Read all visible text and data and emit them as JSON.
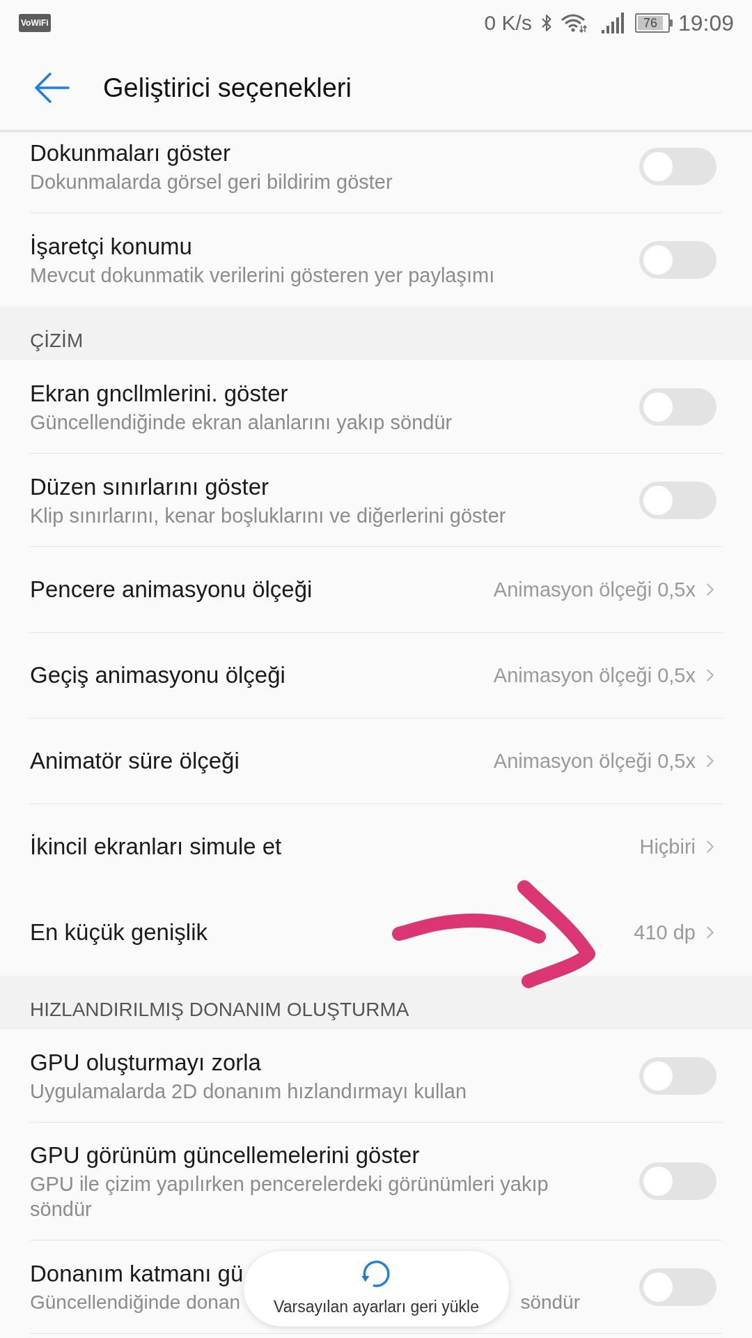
{
  "status_bar": {
    "badge": "VoWiFi",
    "net_speed": "0 K/s",
    "battery": "76",
    "time": "19:09"
  },
  "header": {
    "title": "Geliştirici seçenekleri"
  },
  "sections": [
    {
      "rows": [
        {
          "kind": "toggle",
          "title": "Dokunmaları göster",
          "subtitle": "Dokunmalarda görsel geri bildirim göster",
          "on": false,
          "divider": true
        },
        {
          "kind": "toggle",
          "title": "İşaretçi konumu",
          "subtitle": "Mevcut dokunmatik verilerini gösteren yer paylaşımı",
          "on": false,
          "divider": false
        }
      ]
    },
    {
      "heading": "ÇİZİM",
      "rows": [
        {
          "kind": "toggle",
          "title": "Ekran gncllmlerini. göster",
          "subtitle": "Güncellendiğinde ekran alanlarını yakıp söndür",
          "on": false,
          "divider": true
        },
        {
          "kind": "toggle",
          "title": "Düzen sınırlarını göster",
          "subtitle": "Klip sınırlarını, kenar boşluklarını ve diğerlerini göster",
          "on": false,
          "divider": true
        },
        {
          "kind": "link",
          "title": "Pencere animasyonu ölçeği",
          "value": "Animasyon ölçeği 0,5x",
          "divider": true
        },
        {
          "kind": "link",
          "title": "Geçiş animasyonu ölçeği",
          "value": "Animasyon ölçeği 0,5x",
          "divider": true
        },
        {
          "kind": "link",
          "title": "Animatör süre ölçeği",
          "value": "Animasyon ölçeği 0,5x",
          "divider": true
        },
        {
          "kind": "link",
          "title": "İkincil ekranları simule et",
          "value": "Hiçbiri",
          "divider": false
        },
        {
          "kind": "link",
          "title": "En küçük genişlik",
          "value": "410 dp",
          "divider": false
        }
      ]
    },
    {
      "heading": "HIZLANDIRILMIŞ DONANIM OLUŞTURMA",
      "rows": [
        {
          "kind": "toggle",
          "title": "GPU oluşturmayı zorla",
          "subtitle": "Uygulamalarda 2D donanım hızlandırmayı kullan",
          "on": false,
          "divider": true
        },
        {
          "kind": "toggle",
          "title": "GPU görünüm güncellemelerini göster",
          "subtitle": "GPU ile çizim yapılırken pencerelerdeki görünümleri yakıp söndür",
          "on": false,
          "divider": true
        },
        {
          "kind": "toggle",
          "title": "Donanım katmanı gü",
          "subtitle_parts": [
            "Güncellendiğinde donan",
            "söndür"
          ],
          "on": false,
          "divider": true
        }
      ]
    }
  ],
  "restore_button": {
    "label": "Varsayılan ayarları geri yükle"
  }
}
